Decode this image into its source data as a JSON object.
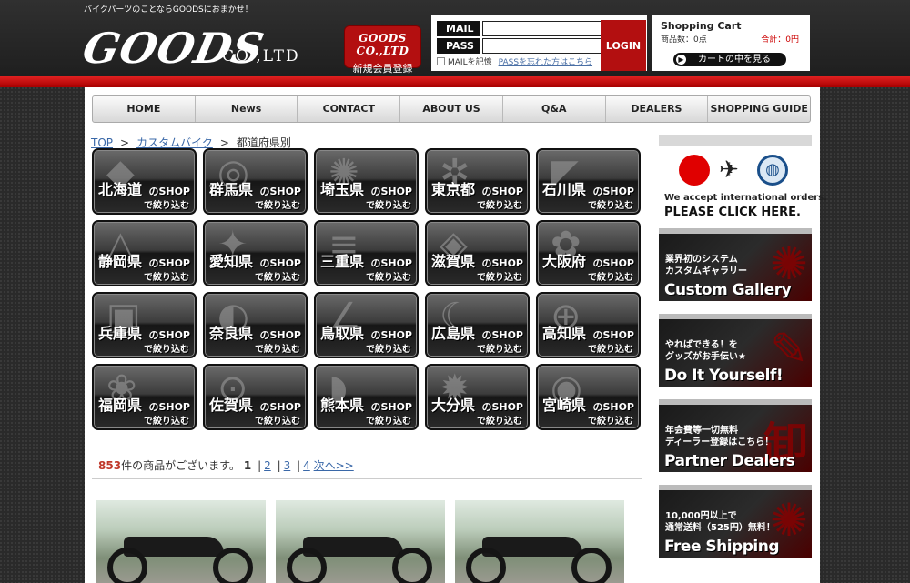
{
  "header": {
    "tagline": "バイクパーツのことならGOODSにおまかせ！",
    "logo_text": "GOODS",
    "logo_suffix": "CO.,LTD",
    "register_logo": "GOODS CO.,LTD",
    "register_label": "新規会員登録"
  },
  "login": {
    "mail_label": "MAIL",
    "pass_label": "PASS",
    "mail_value": "",
    "pass_value": "",
    "login_button": "LOGIN",
    "remember_label": "MAILを記憶",
    "forgot_link": "PASSを忘れた方はこちら"
  },
  "cart": {
    "title": "Shopping Cart",
    "quantity": "商品数：0点",
    "total": "合計：0円",
    "view_button": "カートの中を見る"
  },
  "nav": {
    "items": [
      "HOME",
      "News",
      "CONTACT",
      "ABOUT US",
      "Q&A",
      "DEALERS",
      "SHOPPING GUIDE"
    ]
  },
  "breadcrumb": {
    "items": [
      "TOP",
      "カスタムバイク",
      "都道府県別"
    ],
    "separator": ">"
  },
  "prefectures": {
    "shop_suffix": "のSHOP",
    "filter_label": "で絞り込む",
    "items": [
      {
        "name": "北海道",
        "emblem": "◆"
      },
      {
        "name": "群馬県",
        "emblem": "◎"
      },
      {
        "name": "埼玉県",
        "emblem": "✺"
      },
      {
        "name": "東京都",
        "emblem": "✲"
      },
      {
        "name": "石川県",
        "emblem": "◤"
      },
      {
        "name": "静岡県",
        "emblem": "△"
      },
      {
        "name": "愛知県",
        "emblem": "✦"
      },
      {
        "name": "三重県",
        "emblem": "≡"
      },
      {
        "name": "滋賀県",
        "emblem": "◈"
      },
      {
        "name": "大阪府",
        "emblem": "✿"
      },
      {
        "name": "兵庫県",
        "emblem": "▣"
      },
      {
        "name": "奈良県",
        "emblem": "◐"
      },
      {
        "name": "鳥取県",
        "emblem": "∠"
      },
      {
        "name": "広島県",
        "emblem": "☾"
      },
      {
        "name": "高知県",
        "emblem": "⊕"
      },
      {
        "name": "福岡県",
        "emblem": "❀"
      },
      {
        "name": "佐賀県",
        "emblem": "⊙"
      },
      {
        "name": "熊本県",
        "emblem": "◗"
      },
      {
        "name": "大分県",
        "emblem": "✹"
      },
      {
        "name": "宮崎県",
        "emblem": "◉"
      }
    ]
  },
  "results": {
    "count": "853",
    "count_suffix": "件の商品がございます。",
    "current_page": "1",
    "pages": [
      "2",
      "3",
      "4"
    ],
    "next_label": "次へ>>"
  },
  "products": [
    {
      "alt": "custom bike 1"
    },
    {
      "alt": "custom bike 2"
    },
    {
      "alt": "custom bike 3"
    }
  ],
  "sidebar": {
    "intl_line1": "We accept international orders.",
    "intl_line2": "PLEASE CLICK HERE.",
    "banners": [
      {
        "jp": "業界初のシステム\nカスタムギャラリー",
        "en": "Custom Gallery"
      },
      {
        "jp": "やればできる！を\nグッズがお手伝い★",
        "en": "Do It Yourself!"
      },
      {
        "jp": "年会費等一切無料\nディーラー登録はこちら！",
        "en": "Partner Dealers"
      },
      {
        "jp": "10,000円以上で\n通常送料（525円）無料！",
        "en": "Free Shipping"
      }
    ]
  },
  "colors": {
    "accent_red": "#b30f10",
    "link_blue": "#3a68a8"
  }
}
